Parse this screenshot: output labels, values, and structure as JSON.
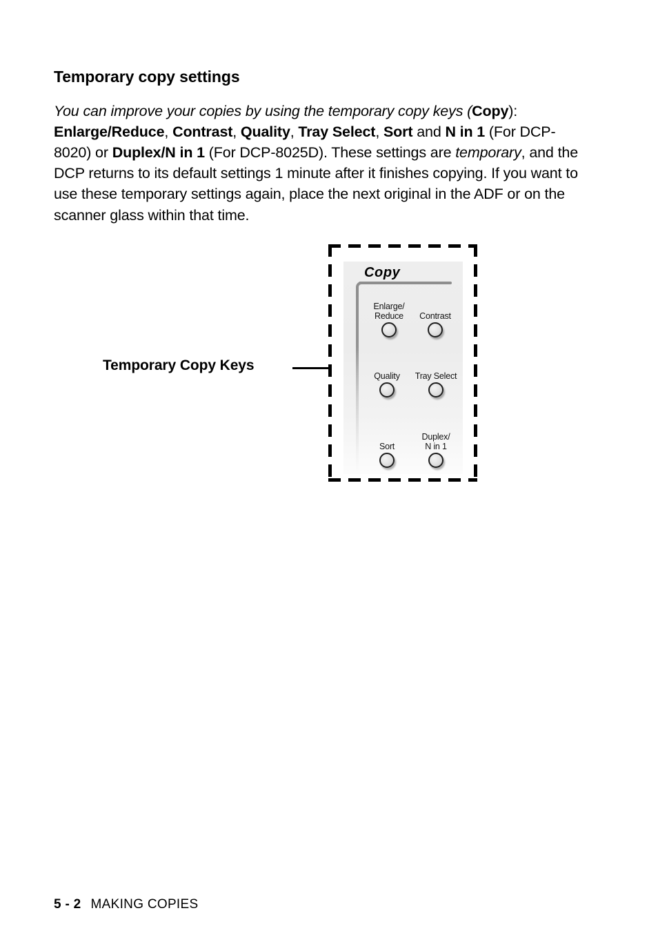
{
  "page": {
    "heading": "Temporary copy settings",
    "body": {
      "segments": [
        {
          "text": "You can improve your copies by using the temporary copy keys (",
          "style": "italic"
        },
        {
          "text": "Copy",
          "style": "bold"
        },
        {
          "text": "): ",
          "style": "normal"
        },
        {
          "text": "Enlarge/Reduce",
          "style": "bold"
        },
        {
          "text": ", ",
          "style": "normal"
        },
        {
          "text": "Contrast",
          "style": "bold"
        },
        {
          "text": ", ",
          "style": "normal"
        },
        {
          "text": "Quality",
          "style": "bold"
        },
        {
          "text": ", ",
          "style": "normal"
        },
        {
          "text": "Tray Select",
          "style": "bold"
        },
        {
          "text": ", ",
          "style": "normal"
        },
        {
          "text": "Sort",
          "style": "bold"
        },
        {
          "text": " and ",
          "style": "normal"
        },
        {
          "text": "N in 1",
          "style": "bold"
        },
        {
          "text": " (For DCP-8020) or ",
          "style": "normal"
        },
        {
          "text": "Duplex/N in 1",
          "style": "bold"
        },
        {
          "text": " (For DCP-8025D). These settings are ",
          "style": "normal"
        },
        {
          "text": "temporary",
          "style": "italic"
        },
        {
          "text": ", and the DCP returns to its default settings 1 minute after it finishes copying. If you want to use these temporary settings again, place the next original in the ADF or on the scanner glass within that time.",
          "style": "normal"
        }
      ]
    }
  },
  "figure": {
    "callout_label": "Temporary Copy Keys",
    "panel": {
      "logo": "Copy",
      "keys": [
        {
          "id": "enlarge-reduce",
          "label": "Enlarge/\nReduce"
        },
        {
          "id": "contrast",
          "label": "Contrast"
        },
        {
          "id": "quality",
          "label": "Quality"
        },
        {
          "id": "tray-select",
          "label": "Tray Select"
        },
        {
          "id": "sort",
          "label": "Sort"
        },
        {
          "id": "duplex-n-in-1",
          "label": "Duplex/\nN in 1"
        }
      ]
    },
    "colors": {
      "panel_background": "#ececec",
      "panel_accent": "#8e8e8e",
      "key_outline": "#1c1c1c",
      "dashed_border": "#000000"
    }
  },
  "footer": {
    "folio": "5 - 2",
    "section": "MAKING COPIES"
  }
}
